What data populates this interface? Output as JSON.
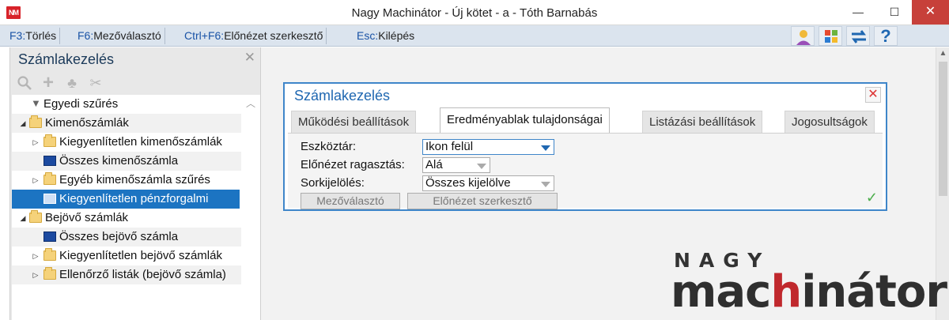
{
  "window": {
    "title": "Nagy Machinátor - Új kötet - a - Tóth Barnabás",
    "app_icon": "NM",
    "minimize": "—",
    "maximize": "☐",
    "close": "✕"
  },
  "shortcuts": [
    {
      "key": "F3:",
      "label": "Törlés"
    },
    {
      "key": "F6:",
      "label": "Mezőválasztó"
    },
    {
      "key": "Ctrl+F6:",
      "label": "Előnézet szerkesztő"
    },
    {
      "key": "Esc:",
      "label": "Kilépés"
    }
  ],
  "toolbar_icons": [
    "user-icon",
    "windows-icon",
    "sync-arrows-icon",
    "help-icon"
  ],
  "toolbar_glyphs": {
    "user": "👤",
    "windows": "▦",
    "sync": "⇄",
    "help": "?"
  },
  "left_panel": {
    "title": "Számlakezelés",
    "close": "✕",
    "tools": {
      "search": "🔍",
      "add": "+",
      "tree": "♣",
      "tools": "✂"
    },
    "tree": [
      {
        "label": "Egyedi szűrés"
      },
      {
        "label": "Kimenőszámlák"
      },
      {
        "label": "Kiegyenlítetlen kimenőszámlák"
      },
      {
        "label": "Összes kimenőszámla"
      },
      {
        "label": "Egyéb kimenőszámla szűrés"
      },
      {
        "label": "Kiegyenlítetlen pénzforgalmi"
      },
      {
        "label": "Bejövő számlák"
      },
      {
        "label": "Összes bejövő számla"
      },
      {
        "label": "Kiegyenlítetlen bejövő számlák"
      },
      {
        "label": "Ellenőrző listák (bejövő számla)"
      }
    ],
    "expanders": {
      "open": "◢",
      "closed": "▷"
    }
  },
  "dialog": {
    "title": "Számlakezelés",
    "close": "✕",
    "tabs": [
      {
        "label": "Működési beállítások"
      },
      {
        "label": "Eredményablak tulajdonságai"
      },
      {
        "label": "Listázási beállítások"
      },
      {
        "label": "Jogosultságok"
      }
    ],
    "fields": [
      {
        "label": "Eszköztár:",
        "value": "Ikon felül"
      },
      {
        "label": "Előnézet ragasztás:",
        "value": "Alá"
      },
      {
        "label": "Sorkijelölés:",
        "value": "Összes kijelölve"
      }
    ],
    "buttons": {
      "field_chooser": "Mezőválasztó",
      "preview_editor": "Előnézet szerkesztő"
    },
    "ok_mark": "✓"
  },
  "logo": {
    "top": "NAGY",
    "bottom_a": "mac",
    "bottom_accent": "h",
    "bottom_b": "inátor"
  },
  "colors": {
    "accent": "#1f67b1",
    "selection": "#1c74c2",
    "brand_red": "#c0282d",
    "close_red": "#c7403a"
  }
}
